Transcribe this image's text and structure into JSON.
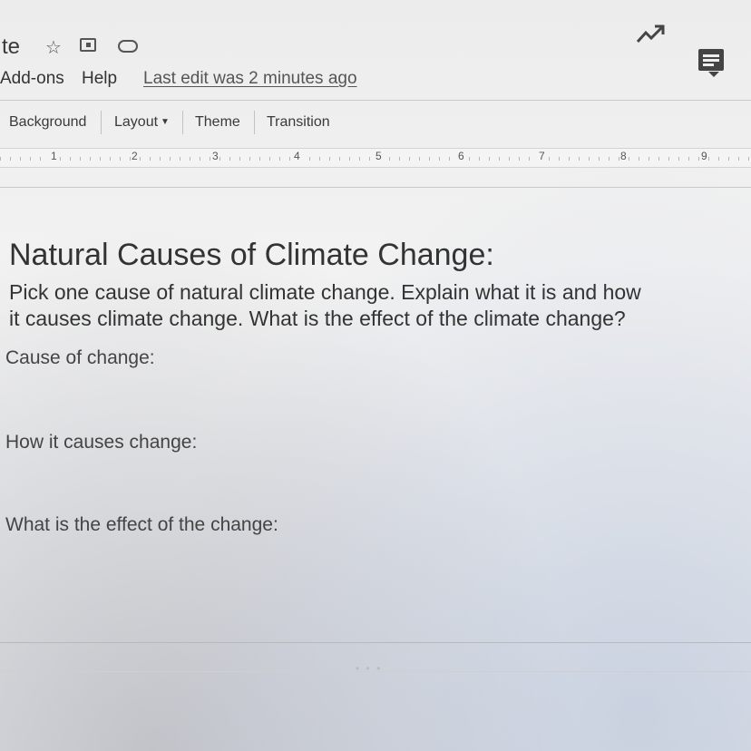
{
  "header": {
    "doc_title": "te",
    "menu": [
      "Add-ons",
      "Help"
    ],
    "last_edit": "Last edit was 2 minutes ago"
  },
  "toolbar": {
    "background": "Background",
    "layout": "Layout",
    "theme": "Theme",
    "transition": "Transition"
  },
  "ruler": {
    "numbers": [
      "1",
      "2",
      "3",
      "4",
      "5",
      "6",
      "7",
      "8",
      "9"
    ]
  },
  "slide": {
    "heading": "Natural Causes of Climate Change:",
    "instructions_line1": "Pick one cause of natural climate change.  Explain what it is and how",
    "instructions_line2": "it causes climate change.  What is the effect of the climate change?",
    "prompts": [
      "Cause of change:",
      "How it causes change:",
      "What is the effect of the change:"
    ]
  },
  "icons": {
    "title_bar": [
      "star-icon",
      "move-to-folder-icon",
      "cloud-status-icon"
    ],
    "right": [
      "activity-trend-icon",
      "comment-icon"
    ]
  }
}
